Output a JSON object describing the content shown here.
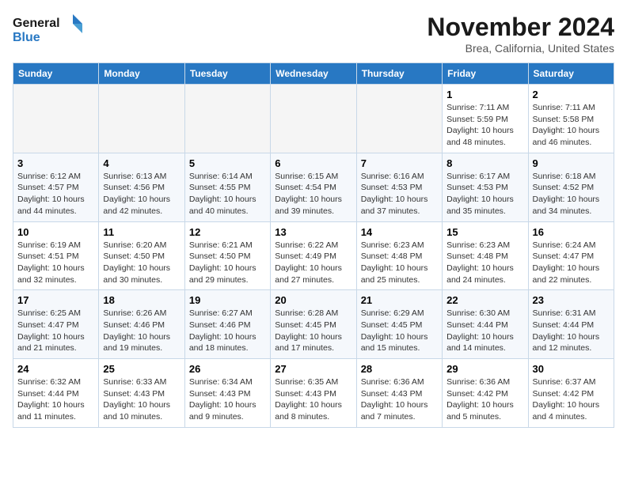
{
  "header": {
    "logo_line1": "General",
    "logo_line2": "Blue",
    "month_title": "November 2024",
    "location": "Brea, California, United States"
  },
  "days_of_week": [
    "Sunday",
    "Monday",
    "Tuesday",
    "Wednesday",
    "Thursday",
    "Friday",
    "Saturday"
  ],
  "weeks": [
    {
      "days": [
        {
          "number": "",
          "sunrise": "",
          "sunset": "",
          "daylight": "",
          "empty": true
        },
        {
          "number": "",
          "sunrise": "",
          "sunset": "",
          "daylight": "",
          "empty": true
        },
        {
          "number": "",
          "sunrise": "",
          "sunset": "",
          "daylight": "",
          "empty": true
        },
        {
          "number": "",
          "sunrise": "",
          "sunset": "",
          "daylight": "",
          "empty": true
        },
        {
          "number": "",
          "sunrise": "",
          "sunset": "",
          "daylight": "",
          "empty": true
        },
        {
          "number": "1",
          "sunrise": "Sunrise: 7:11 AM",
          "sunset": "Sunset: 5:59 PM",
          "daylight": "Daylight: 10 hours and 48 minutes.",
          "empty": false
        },
        {
          "number": "2",
          "sunrise": "Sunrise: 7:11 AM",
          "sunset": "Sunset: 5:58 PM",
          "daylight": "Daylight: 10 hours and 46 minutes.",
          "empty": false
        }
      ]
    },
    {
      "days": [
        {
          "number": "3",
          "sunrise": "Sunrise: 6:12 AM",
          "sunset": "Sunset: 4:57 PM",
          "daylight": "Daylight: 10 hours and 44 minutes.",
          "empty": false
        },
        {
          "number": "4",
          "sunrise": "Sunrise: 6:13 AM",
          "sunset": "Sunset: 4:56 PM",
          "daylight": "Daylight: 10 hours and 42 minutes.",
          "empty": false
        },
        {
          "number": "5",
          "sunrise": "Sunrise: 6:14 AM",
          "sunset": "Sunset: 4:55 PM",
          "daylight": "Daylight: 10 hours and 40 minutes.",
          "empty": false
        },
        {
          "number": "6",
          "sunrise": "Sunrise: 6:15 AM",
          "sunset": "Sunset: 4:54 PM",
          "daylight": "Daylight: 10 hours and 39 minutes.",
          "empty": false
        },
        {
          "number": "7",
          "sunrise": "Sunrise: 6:16 AM",
          "sunset": "Sunset: 4:53 PM",
          "daylight": "Daylight: 10 hours and 37 minutes.",
          "empty": false
        },
        {
          "number": "8",
          "sunrise": "Sunrise: 6:17 AM",
          "sunset": "Sunset: 4:53 PM",
          "daylight": "Daylight: 10 hours and 35 minutes.",
          "empty": false
        },
        {
          "number": "9",
          "sunrise": "Sunrise: 6:18 AM",
          "sunset": "Sunset: 4:52 PM",
          "daylight": "Daylight: 10 hours and 34 minutes.",
          "empty": false
        }
      ]
    },
    {
      "days": [
        {
          "number": "10",
          "sunrise": "Sunrise: 6:19 AM",
          "sunset": "Sunset: 4:51 PM",
          "daylight": "Daylight: 10 hours and 32 minutes.",
          "empty": false
        },
        {
          "number": "11",
          "sunrise": "Sunrise: 6:20 AM",
          "sunset": "Sunset: 4:50 PM",
          "daylight": "Daylight: 10 hours and 30 minutes.",
          "empty": false
        },
        {
          "number": "12",
          "sunrise": "Sunrise: 6:21 AM",
          "sunset": "Sunset: 4:50 PM",
          "daylight": "Daylight: 10 hours and 29 minutes.",
          "empty": false
        },
        {
          "number": "13",
          "sunrise": "Sunrise: 6:22 AM",
          "sunset": "Sunset: 4:49 PM",
          "daylight": "Daylight: 10 hours and 27 minutes.",
          "empty": false
        },
        {
          "number": "14",
          "sunrise": "Sunrise: 6:23 AM",
          "sunset": "Sunset: 4:48 PM",
          "daylight": "Daylight: 10 hours and 25 minutes.",
          "empty": false
        },
        {
          "number": "15",
          "sunrise": "Sunrise: 6:23 AM",
          "sunset": "Sunset: 4:48 PM",
          "daylight": "Daylight: 10 hours and 24 minutes.",
          "empty": false
        },
        {
          "number": "16",
          "sunrise": "Sunrise: 6:24 AM",
          "sunset": "Sunset: 4:47 PM",
          "daylight": "Daylight: 10 hours and 22 minutes.",
          "empty": false
        }
      ]
    },
    {
      "days": [
        {
          "number": "17",
          "sunrise": "Sunrise: 6:25 AM",
          "sunset": "Sunset: 4:47 PM",
          "daylight": "Daylight: 10 hours and 21 minutes.",
          "empty": false
        },
        {
          "number": "18",
          "sunrise": "Sunrise: 6:26 AM",
          "sunset": "Sunset: 4:46 PM",
          "daylight": "Daylight: 10 hours and 19 minutes.",
          "empty": false
        },
        {
          "number": "19",
          "sunrise": "Sunrise: 6:27 AM",
          "sunset": "Sunset: 4:46 PM",
          "daylight": "Daylight: 10 hours and 18 minutes.",
          "empty": false
        },
        {
          "number": "20",
          "sunrise": "Sunrise: 6:28 AM",
          "sunset": "Sunset: 4:45 PM",
          "daylight": "Daylight: 10 hours and 17 minutes.",
          "empty": false
        },
        {
          "number": "21",
          "sunrise": "Sunrise: 6:29 AM",
          "sunset": "Sunset: 4:45 PM",
          "daylight": "Daylight: 10 hours and 15 minutes.",
          "empty": false
        },
        {
          "number": "22",
          "sunrise": "Sunrise: 6:30 AM",
          "sunset": "Sunset: 4:44 PM",
          "daylight": "Daylight: 10 hours and 14 minutes.",
          "empty": false
        },
        {
          "number": "23",
          "sunrise": "Sunrise: 6:31 AM",
          "sunset": "Sunset: 4:44 PM",
          "daylight": "Daylight: 10 hours and 12 minutes.",
          "empty": false
        }
      ]
    },
    {
      "days": [
        {
          "number": "24",
          "sunrise": "Sunrise: 6:32 AM",
          "sunset": "Sunset: 4:44 PM",
          "daylight": "Daylight: 10 hours and 11 minutes.",
          "empty": false
        },
        {
          "number": "25",
          "sunrise": "Sunrise: 6:33 AM",
          "sunset": "Sunset: 4:43 PM",
          "daylight": "Daylight: 10 hours and 10 minutes.",
          "empty": false
        },
        {
          "number": "26",
          "sunrise": "Sunrise: 6:34 AM",
          "sunset": "Sunset: 4:43 PM",
          "daylight": "Daylight: 10 hours and 9 minutes.",
          "empty": false
        },
        {
          "number": "27",
          "sunrise": "Sunrise: 6:35 AM",
          "sunset": "Sunset: 4:43 PM",
          "daylight": "Daylight: 10 hours and 8 minutes.",
          "empty": false
        },
        {
          "number": "28",
          "sunrise": "Sunrise: 6:36 AM",
          "sunset": "Sunset: 4:43 PM",
          "daylight": "Daylight: 10 hours and 7 minutes.",
          "empty": false
        },
        {
          "number": "29",
          "sunrise": "Sunrise: 6:36 AM",
          "sunset": "Sunset: 4:42 PM",
          "daylight": "Daylight: 10 hours and 5 minutes.",
          "empty": false
        },
        {
          "number": "30",
          "sunrise": "Sunrise: 6:37 AM",
          "sunset": "Sunset: 4:42 PM",
          "daylight": "Daylight: 10 hours and 4 minutes.",
          "empty": false
        }
      ]
    }
  ]
}
